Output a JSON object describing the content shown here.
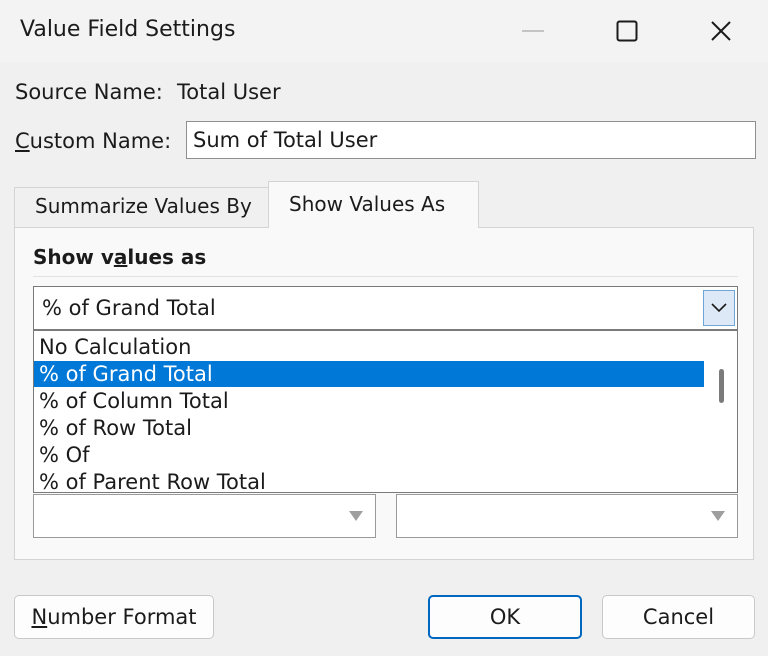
{
  "window": {
    "title": "Value Field Settings"
  },
  "source": {
    "label": "Source Name:",
    "value": "Total User"
  },
  "custom_name": {
    "label_underlined": "C",
    "label_rest": "ustom Name:",
    "value": "Sum of Total User"
  },
  "tabs": [
    {
      "label": "Summarize Values By",
      "active": false
    },
    {
      "label": "Show Values As",
      "active": true
    }
  ],
  "show_values_as": {
    "label_pre": "Show v",
    "label_underlined": "a",
    "label_post": "lues as",
    "selected": "% of Grand Total",
    "options": [
      {
        "label": "No Calculation",
        "selected": false
      },
      {
        "label": "% of Grand Total",
        "selected": true
      },
      {
        "label": "% of Column Total",
        "selected": false
      },
      {
        "label": "% of Row Total",
        "selected": false
      },
      {
        "label": "% Of",
        "selected": false
      },
      {
        "label": "% of Parent Row Total",
        "selected": false
      }
    ]
  },
  "buttons": {
    "number_format_underlined": "N",
    "number_format_rest": "umber Format",
    "ok": "OK",
    "cancel": "Cancel"
  },
  "colors": {
    "selection": "#0078d7",
    "ok_border": "#0067c0"
  },
  "icons": {
    "minimize": "minimize-icon",
    "maximize": "maximize-icon",
    "close": "close-icon",
    "dropdown": "chevron-down-icon"
  }
}
